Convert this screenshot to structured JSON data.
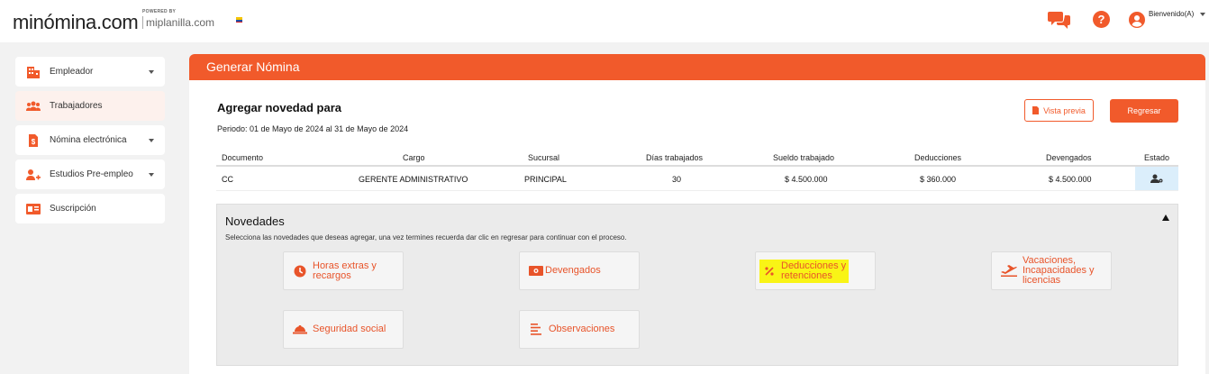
{
  "header": {
    "logo": "minómina.com",
    "powered_label": "POWERED BY",
    "powered_brand": "miplanilla.com",
    "welcome": "Bienvenido(A)"
  },
  "colors": {
    "accent": "#f15a2b",
    "highlight": "#f9f416",
    "state_bg": "#dbeefb"
  },
  "sidebar": {
    "items": [
      {
        "label": "Empleador",
        "icon": "building-icon",
        "has_dropdown": true
      },
      {
        "label": "Trabajadores",
        "icon": "users-icon",
        "has_dropdown": false,
        "active": true
      },
      {
        "label": "Nómina electrónica",
        "icon": "invoice-icon",
        "has_dropdown": true
      },
      {
        "label": "Estudios Pre-empleo",
        "icon": "user-plus-icon",
        "has_dropdown": true
      },
      {
        "label": "Suscripción",
        "icon": "id-card-icon",
        "has_dropdown": false
      }
    ]
  },
  "main": {
    "title": "Generar Nómina",
    "subtitle": "Agregar novedad para",
    "period": "Periodo: 01 de Mayo de 2024 al 31 de Mayo de 2024",
    "preview_button": "Vista previa",
    "back_button": "Regresar",
    "table": {
      "headers": [
        "Documento",
        "Cargo",
        "Sucursal",
        "Días trabajados",
        "Sueldo trabajado",
        "Deducciones",
        "Devengados",
        "Estado"
      ],
      "row": {
        "documento": "CC",
        "cargo": "GERENTE ADMINISTRATIVO",
        "sucursal": "PRINCIPAL",
        "dias": "30",
        "sueldo": "$ 4.500.000",
        "deducciones": "$ 360.000",
        "devengados": "$ 4.500.000"
      }
    },
    "novedades": {
      "title": "Novedades",
      "description": "Selecciona las novedades que deseas agregar, una vez termines recuerda dar clic en regresar para continuar con el proceso.",
      "cards": [
        {
          "line1": "Horas extras y",
          "line2": "recargos",
          "icon": "clock-icon"
        },
        {
          "line1": "Devengados",
          "icon": "money-icon"
        },
        {
          "line1": "Deducciones y",
          "line2": "retenciones",
          "icon": "percent-icon"
        },
        {
          "line1": "Vacaciones,",
          "line2": "Incapacidades y",
          "line3": "licencias",
          "icon": "airplane-icon"
        },
        {
          "line1": "Seguridad social",
          "icon": "helmet-icon"
        },
        {
          "line1": "Observaciones",
          "icon": "list-icon"
        }
      ]
    }
  }
}
